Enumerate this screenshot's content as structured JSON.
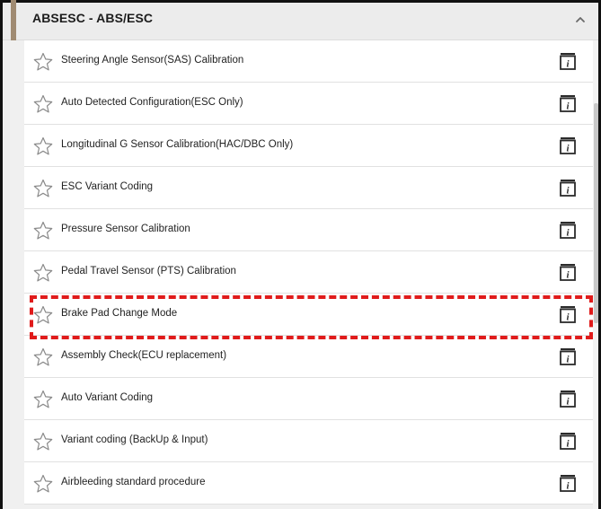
{
  "panel": {
    "title": "ABSESC - ABS/ESC",
    "collapse_icon": "chevron-up-icon"
  },
  "items": [
    {
      "label": "Steering Angle Sensor(SAS) Calibration"
    },
    {
      "label": "Auto Detected Configuration(ESC Only)"
    },
    {
      "label": "Longitudinal G Sensor Calibration(HAC/DBC Only)"
    },
    {
      "label": "ESC Variant Coding"
    },
    {
      "label": "Pressure Sensor Calibration"
    },
    {
      "label": "Pedal Travel Sensor (PTS) Calibration"
    },
    {
      "label": "Brake Pad Change Mode",
      "highlighted": true
    },
    {
      "label": "Assembly Check(ECU replacement)"
    },
    {
      "label": "Auto Variant Coding"
    },
    {
      "label": "Variant coding (BackUp & Input)"
    },
    {
      "label": "Airbleeding standard procedure"
    }
  ],
  "icons": {
    "favorite": "star-outline-icon",
    "info": "info-book-icon"
  },
  "colors": {
    "highlight": "#e01b1b",
    "accent": "#a08b72"
  }
}
